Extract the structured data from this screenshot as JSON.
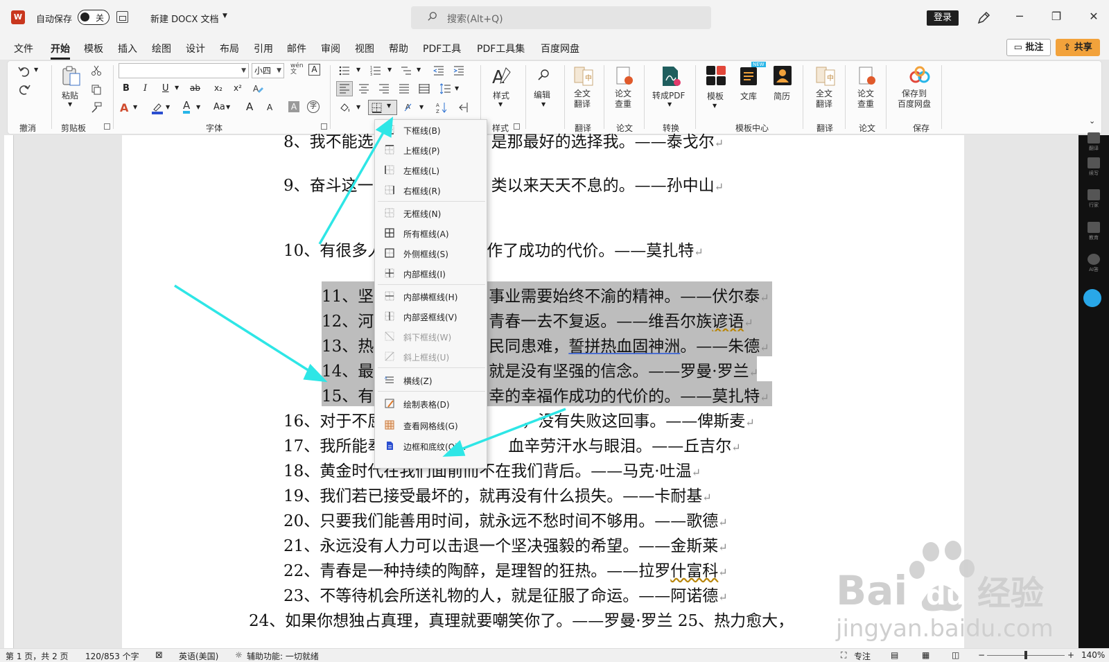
{
  "titlebar": {
    "app_logo": "W",
    "autosave_label": "自动保存",
    "autosave_state": "关",
    "doc_title": "新建 DOCX 文档",
    "search_placeholder": "搜索(Alt+Q)",
    "login_label": "登录"
  },
  "menu": {
    "tabs": [
      "文件",
      "开始",
      "模板",
      "插入",
      "绘图",
      "设计",
      "布局",
      "引用",
      "邮件",
      "审阅",
      "视图",
      "帮助",
      "PDF工具",
      "PDF工具集",
      "百度网盘"
    ],
    "active_tab": "开始",
    "comment_label": "批注",
    "share_label": "共享"
  },
  "ribbon": {
    "groups": {
      "undo": "撤消",
      "clipboard": "剪贴板",
      "font": "字体",
      "styles": "样式",
      "translate": "翻译",
      "paper": "论文",
      "convert": "转换",
      "template_center": "模板中心",
      "translate2": "翻译",
      "paper2": "论文",
      "save": "保存"
    },
    "paste_label": "粘贴",
    "font_size_value": "小四",
    "style_label": "样式",
    "edit_label": "编辑",
    "full_translate_label": "全文\n翻译",
    "paper_check_label": "论文\n查重",
    "to_pdf_label": "转成PDF",
    "template_label": "模板",
    "library_label": "文库",
    "resume_label": "简历",
    "full_translate2_label": "全文\n翻译",
    "paper_check2_label": "论文\n查重",
    "save_baidu_label": "保存到\n百度网盘",
    "new_badge": "NEW",
    "font_format_labels": [
      "B",
      "I",
      "U",
      "ab",
      "x₂",
      "x²",
      "Aa",
      "A",
      "A"
    ]
  },
  "border_menu": {
    "items": [
      {
        "label": "下框线(B)",
        "enabled": true
      },
      {
        "label": "上框线(P)",
        "enabled": true
      },
      {
        "label": "左框线(L)",
        "enabled": true
      },
      {
        "label": "右框线(R)",
        "enabled": true
      },
      {
        "label": "无框线(N)",
        "enabled": true
      },
      {
        "label": "所有框线(A)",
        "enabled": true
      },
      {
        "label": "外侧框线(S)",
        "enabled": true
      },
      {
        "label": "内部框线(I)",
        "enabled": true
      },
      {
        "label": "内部横框线(H)",
        "enabled": true
      },
      {
        "label": "内部竖框线(V)",
        "enabled": true
      },
      {
        "label": "斜下框线(W)",
        "enabled": false
      },
      {
        "label": "斜上框线(U)",
        "enabled": false
      },
      {
        "label": "横线(Z)",
        "enabled": true
      },
      {
        "label": "绘制表格(D)",
        "enabled": true
      },
      {
        "label": "查看网格线(G)",
        "enabled": true
      },
      {
        "label": "边框和底纹(O)...",
        "enabled": true
      }
    ]
  },
  "document": {
    "lines": [
      {
        "left": "8、我不能选",
        "right": "是那最好的选择我。——泰戈尔"
      },
      {
        "left": "9、奋斗这一",
        "right": "类以来天天不息的。——孙中山"
      },
      {
        "left": "10、有很多人",
        "right": "福作了成功的代价。——莫扎特"
      },
      {
        "left": "11、坚",
        "right": "事业需要始终不渝的精神。——伏尔泰"
      },
      {
        "left": "12、河",
        "right": "青春一去不复返。——维吾尔族",
        "extra": "谚语"
      },
      {
        "left": "13、热",
        "right": "民同患难，",
        "extra": "誓拼热血固神洲",
        "tail": "。——朱德"
      },
      {
        "left": "14、最",
        "right": "就是没有坚强的信念。——罗曼·罗兰"
      },
      {
        "left": "15、有",
        "right": "幸的幸福作成功的代价的。——莫扎特"
      },
      {
        "left": "16、对于不屈",
        "right": "，没有失败这回事。——俾斯麦"
      },
      {
        "left": "17、我所能奉",
        "right": "血辛劳汗水与眼泪。——丘吉尔"
      },
      {
        "text": "18、黄金时代在我们面前而不在我们背后。——马克·吐温"
      },
      {
        "text": "19、我们若已接受最坏的，就再没有什么损失。——卡耐基"
      },
      {
        "text": "20、只要我们能善用时间，就永远不愁时间不够用。——歌德"
      },
      {
        "text": "21、永远没有人力可以击退一个坚决强毅的希望。——金斯莱"
      },
      {
        "text": "22、青春是一种持续的陶醉，是理智的狂热。——拉罗",
        "extra": "什富科"
      },
      {
        "text": "23、不等待机会所送礼物的人，就是征服了命运。——阿诺德"
      },
      {
        "text": "24、如果你想独占真理，真理就要嘲笑你了。——罗曼·罗兰 25、热力愈大，"
      }
    ]
  },
  "right_panel": [
    "翻译",
    "续写",
    "行家",
    "教育",
    "AI答"
  ],
  "statusbar": {
    "page": "第 1 页，共 2 页",
    "words": "120/853 个字",
    "language": "英语(美国)",
    "accessibility": "辅助功能: 一切就绪",
    "focus": "专注",
    "zoom": "140%"
  },
  "watermark": {
    "text1": "Bai",
    "text2": "du",
    "text3": "经验",
    "url": "jingyan.baidu.com"
  },
  "colors": {
    "accent_arrow": "#2ee6e6",
    "share": "#f2a23b",
    "selection": "#bdbdbd"
  }
}
